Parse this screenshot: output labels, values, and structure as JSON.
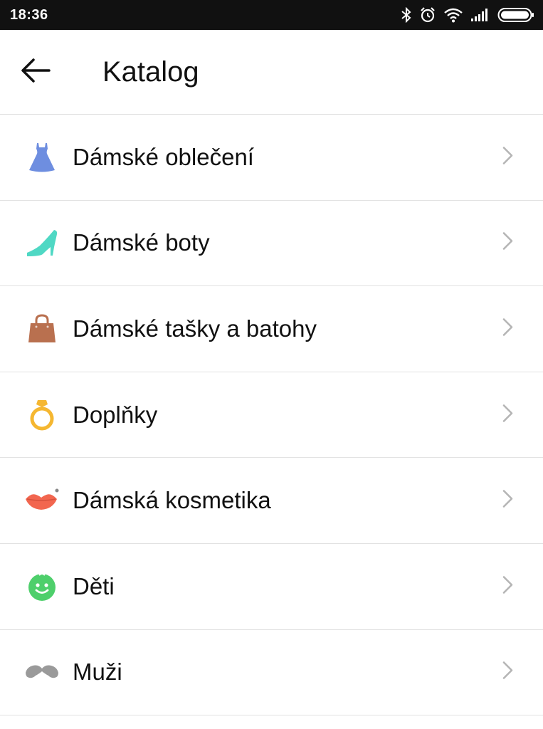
{
  "status_bar": {
    "time": "18:36",
    "icons": [
      "bluetooth-icon",
      "alarm-icon",
      "wifi-icon",
      "signal-icon",
      "battery-icon"
    ]
  },
  "header": {
    "title": "Katalog",
    "back_icon": "arrow-left-icon"
  },
  "catalog": {
    "items": [
      {
        "label": "Dámské oblečení",
        "icon": "dress-icon",
        "color": "#6E8EE0"
      },
      {
        "label": "Dámské boty",
        "icon": "high-heel-icon",
        "color": "#4FD8C4"
      },
      {
        "label": "Dámské tašky a batohy",
        "icon": "handbag-icon",
        "color": "#B9704F"
      },
      {
        "label": "Doplňky",
        "icon": "ring-icon",
        "color": "#F5B731"
      },
      {
        "label": "Dámská kosmetika",
        "icon": "lips-icon",
        "color": "#F2664F"
      },
      {
        "label": "Děti",
        "icon": "baby-face-icon",
        "color": "#4ECF6B"
      },
      {
        "label": "Muži",
        "icon": "mustache-icon",
        "color": "#9A9A9A"
      }
    ]
  },
  "colors": {
    "status_bar_bg": "#111111",
    "divider": "#e2e2e2",
    "chevron": "#b5b5b5"
  }
}
